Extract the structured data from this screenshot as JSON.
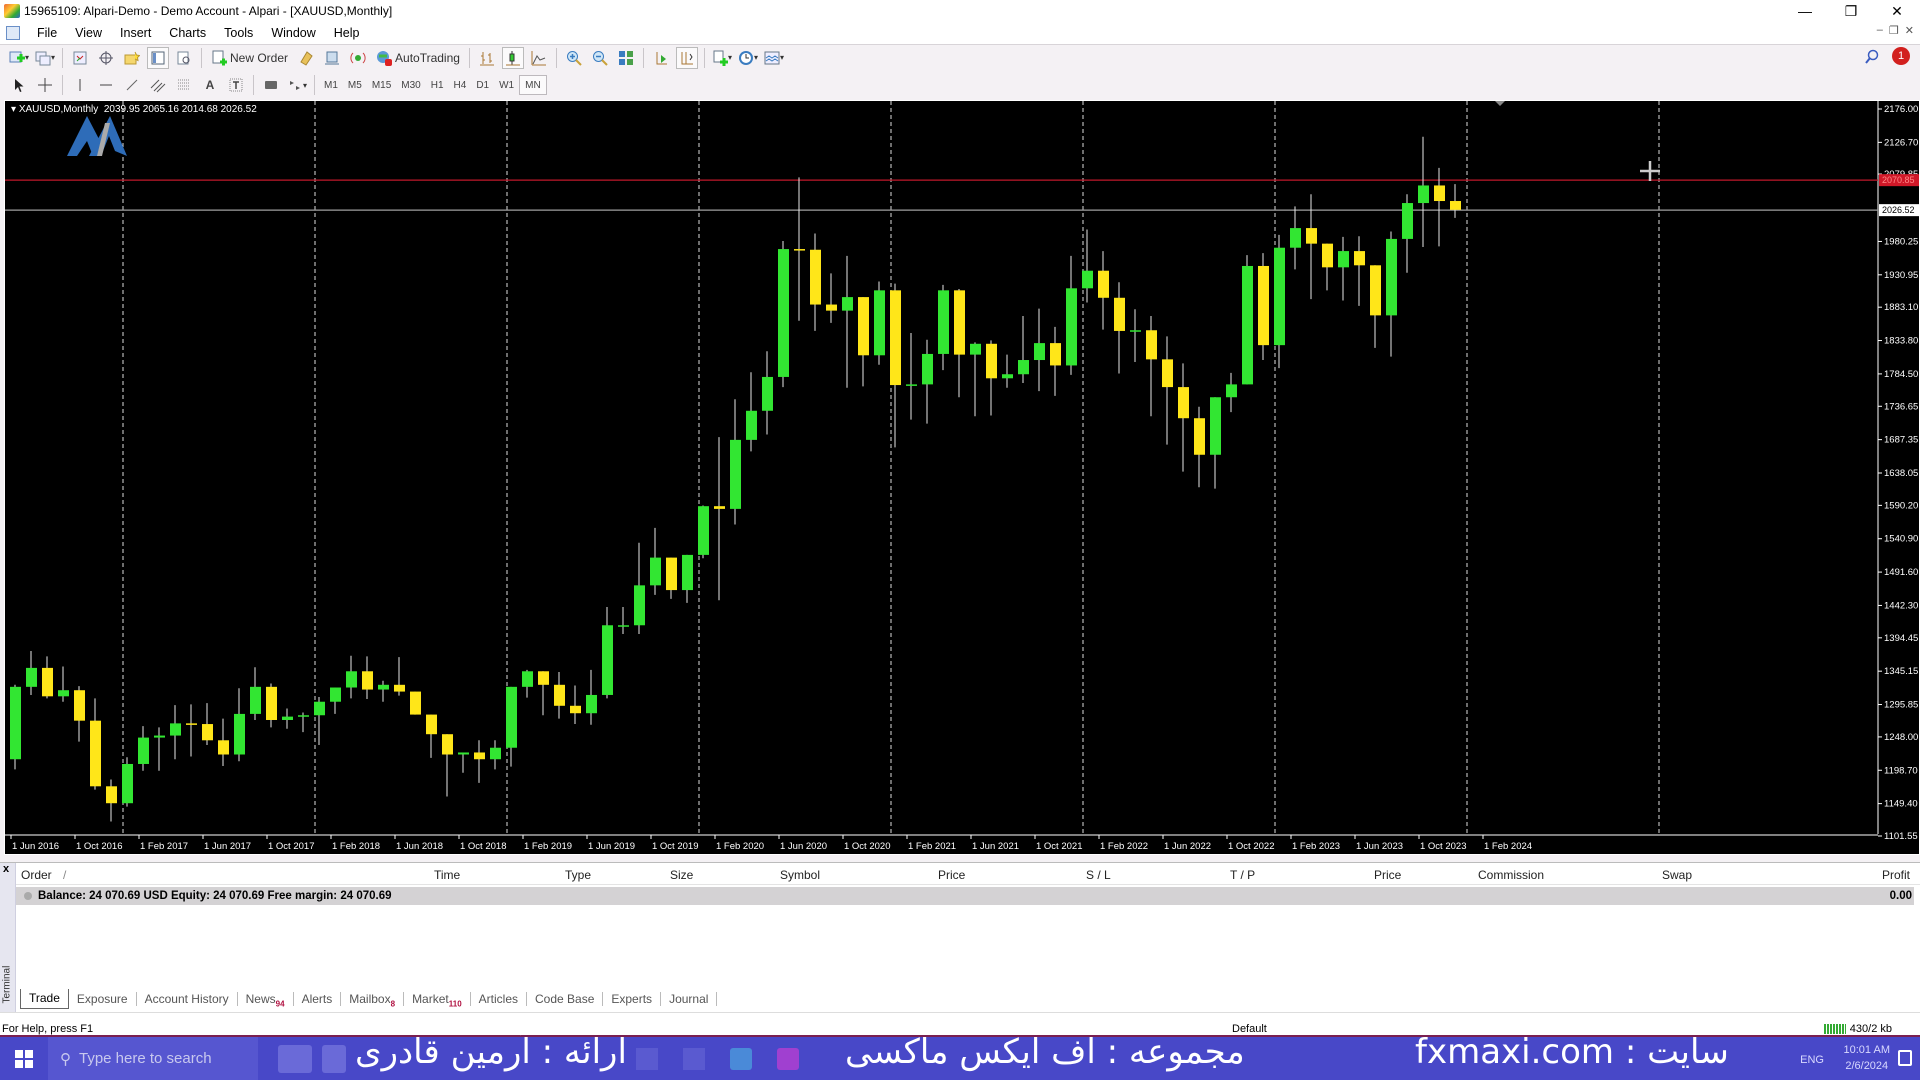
{
  "window": {
    "title": "15965109: Alpari-Demo - Demo Account - Alpari - [XAUUSD,Monthly]",
    "controls": [
      "minimize",
      "restore",
      "close"
    ]
  },
  "menu": [
    "File",
    "View",
    "Insert",
    "Charts",
    "Tools",
    "Window",
    "Help"
  ],
  "toolbar": {
    "new_order": "New Order",
    "auto_trading": "AutoTrading",
    "timeframes": [
      "M1",
      "M5",
      "M15",
      "M30",
      "H1",
      "H4",
      "D1",
      "W1",
      "MN"
    ],
    "active_timeframe": "MN",
    "notification_count": "1"
  },
  "chart": {
    "symbol_legend": "XAUUSD,Monthly  2039.95 2065.16 2014.68 2026.52",
    "current_price_label": "2026.52",
    "hline_price_label": "2070.85",
    "colors": {
      "bull": "#32e632",
      "bear": "#ffe619",
      "wick": "#e8e8e8",
      "hline": "#c0182a",
      "price_line": "#a0a0a0",
      "background": "#000000"
    }
  },
  "chart_data": {
    "type": "candlestick",
    "title": "XAUUSD,Monthly",
    "ohlc_header": {
      "open": 2039.95,
      "high": 2065.16,
      "low": 2014.68,
      "close": 2026.52
    },
    "y_ticks": [
      2176.0,
      2126.7,
      2079.85,
      2026.52,
      1980.25,
      1930.95,
      1883.1,
      1833.8,
      1784.5,
      1736.65,
      1687.35,
      1638.05,
      1590.2,
      1540.9,
      1491.6,
      1442.3,
      1394.45,
      1345.15,
      1295.85,
      1248.0,
      1198.7,
      1149.4,
      1101.55
    ],
    "ylim": [
      1101.55,
      2176.0
    ],
    "x_ticks": [
      "1 Jun 2016",
      "1 Oct 2016",
      "1 Feb 2017",
      "1 Jun 2017",
      "1 Oct 2017",
      "1 Feb 2018",
      "1 Jun 2018",
      "1 Oct 2018",
      "1 Feb 2019",
      "1 Jun 2019",
      "1 Oct 2019",
      "1 Feb 2020",
      "1 Jun 2020",
      "1 Oct 2020",
      "1 Feb 2021",
      "1 Jun 2021",
      "1 Oct 2021",
      "1 Feb 2022",
      "1 Jun 2022",
      "1 Oct 2022",
      "1 Feb 2023",
      "1 Jun 2023",
      "1 Oct 2023",
      "1 Feb 2024"
    ],
    "horizontal_lines": [
      {
        "price": 2070.85,
        "color": "#c0182a"
      },
      {
        "price": 2026.52,
        "color": "#a0a0a0"
      }
    ],
    "ohlc": [
      [
        1215,
        1325,
        1200,
        1322
      ],
      [
        1322,
        1375,
        1310,
        1350
      ],
      [
        1350,
        1367,
        1305,
        1308
      ],
      [
        1308,
        1352,
        1300,
        1317
      ],
      [
        1317,
        1323,
        1241,
        1272
      ],
      [
        1272,
        1305,
        1170,
        1175
      ],
      [
        1175,
        1185,
        1123,
        1150
      ],
      [
        1150,
        1218,
        1145,
        1208
      ],
      [
        1208,
        1264,
        1198,
        1247
      ],
      [
        1247,
        1262,
        1198,
        1250
      ],
      [
        1250,
        1295,
        1215,
        1268
      ],
      [
        1268,
        1296,
        1219,
        1267
      ],
      [
        1267,
        1298,
        1236,
        1243
      ],
      [
        1243,
        1275,
        1205,
        1222
      ],
      [
        1222,
        1320,
        1212,
        1282
      ],
      [
        1282,
        1351,
        1273,
        1322
      ],
      [
        1322,
        1327,
        1262,
        1273
      ],
      [
        1273,
        1290,
        1260,
        1278
      ],
      [
        1278,
        1284,
        1255,
        1280
      ],
      [
        1280,
        1307,
        1236,
        1300
      ],
      [
        1300,
        1320,
        1282,
        1321
      ],
      [
        1321,
        1368,
        1305,
        1345
      ],
      [
        1345,
        1367,
        1304,
        1318
      ],
      [
        1318,
        1331,
        1300,
        1325
      ],
      [
        1325,
        1366,
        1309,
        1315
      ],
      [
        1315,
        1308,
        1282,
        1281
      ],
      [
        1281,
        1262,
        1217,
        1252
      ],
      [
        1252,
        1240,
        1160,
        1222
      ],
      [
        1222,
        1215,
        1195,
        1225
      ],
      [
        1225,
        1243,
        1180,
        1215
      ],
      [
        1215,
        1243,
        1200,
        1232
      ],
      [
        1232,
        1286,
        1204,
        1322
      ],
      [
        1322,
        1347,
        1306,
        1345
      ],
      [
        1345,
        1330,
        1280,
        1325
      ],
      [
        1325,
        1344,
        1275,
        1294
      ],
      [
        1294,
        1324,
        1267,
        1283
      ],
      [
        1283,
        1347,
        1266,
        1310
      ],
      [
        1310,
        1440,
        1305,
        1413
      ],
      [
        1413,
        1440,
        1400,
        1413
      ],
      [
        1413,
        1535,
        1400,
        1472
      ],
      [
        1472,
        1557,
        1458,
        1513
      ],
      [
        1513,
        1500,
        1452,
        1465
      ],
      [
        1465,
        1489,
        1446,
        1517
      ],
      [
        1517,
        1590,
        1512,
        1589
      ],
      [
        1589,
        1691,
        1450,
        1585
      ],
      [
        1585,
        1747,
        1562,
        1687
      ],
      [
        1687,
        1787,
        1670,
        1730
      ],
      [
        1730,
        1818,
        1695,
        1780
      ],
      [
        1780,
        1981,
        1765,
        1969
      ],
      [
        1969,
        2075,
        1863,
        1968
      ],
      [
        1968,
        1992,
        1848,
        1887
      ],
      [
        1887,
        1933,
        1860,
        1878
      ],
      [
        1878,
        1959,
        1764,
        1898
      ],
      [
        1898,
        1875,
        1766,
        1812
      ],
      [
        1812,
        1921,
        1798,
        1908
      ],
      [
        1908,
        1918,
        1676,
        1768
      ],
      [
        1768,
        1845,
        1717,
        1769
      ],
      [
        1769,
        1835,
        1711,
        1814
      ],
      [
        1814,
        1916,
        1790,
        1908
      ],
      [
        1908,
        1910,
        1750,
        1813
      ],
      [
        1813,
        1831,
        1722,
        1829
      ],
      [
        1829,
        1834,
        1723,
        1778
      ],
      [
        1778,
        1813,
        1764,
        1784
      ],
      [
        1784,
        1870,
        1771,
        1805
      ],
      [
        1805,
        1881,
        1759,
        1830
      ],
      [
        1830,
        1854,
        1752,
        1797
      ],
      [
        1797,
        1959,
        1783,
        1911
      ],
      [
        1911,
        1998,
        1890,
        1937
      ],
      [
        1937,
        1966,
        1850,
        1897
      ],
      [
        1897,
        1920,
        1785,
        1848
      ],
      [
        1848,
        1880,
        1802,
        1849
      ],
      [
        1849,
        1870,
        1722,
        1806
      ],
      [
        1806,
        1840,
        1680,
        1765
      ],
      [
        1765,
        1800,
        1640,
        1719
      ],
      [
        1719,
        1736,
        1617,
        1665
      ],
      [
        1665,
        1729,
        1615,
        1750
      ],
      [
        1750,
        1786,
        1728,
        1769
      ],
      [
        1769,
        1960,
        1804,
        1944
      ],
      [
        1944,
        1963,
        1805,
        1827
      ],
      [
        1827,
        1990,
        1793,
        1971
      ],
      [
        1971,
        2032,
        1939,
        2000
      ],
      [
        2000,
        2050,
        1895,
        1977
      ],
      [
        1977,
        1969,
        1908,
        1942
      ],
      [
        1942,
        1987,
        1893,
        1966
      ],
      [
        1966,
        1988,
        1885,
        1945
      ],
      [
        1945,
        1929,
        1823,
        1871
      ],
      [
        1871,
        1995,
        1810,
        1984
      ],
      [
        1984,
        2050,
        1934,
        2037
      ],
      [
        2037,
        2135,
        1972,
        2063
      ],
      [
        2063,
        2089,
        1973,
        2040
      ],
      [
        2040,
        2065,
        2015,
        2027
      ]
    ]
  },
  "terminal": {
    "close_label": "x",
    "side_label": "Terminal",
    "columns": [
      "Order",
      "/",
      "Time",
      "Type",
      "Size",
      "Symbol",
      "Price",
      "S / L",
      "T / P",
      "Price",
      "Commission",
      "Swap",
      "Profit"
    ],
    "balance_text": "Balance: 24 070.69 USD  Equity: 24 070.69  Free margin: 24 070.69",
    "profit": "0.00",
    "tabs": [
      {
        "label": "Trade",
        "badge": "",
        "active": true
      },
      {
        "label": "Exposure",
        "badge": ""
      },
      {
        "label": "Account History",
        "badge": ""
      },
      {
        "label": "News",
        "badge": "94"
      },
      {
        "label": "Alerts",
        "badge": ""
      },
      {
        "label": "Mailbox",
        "badge": "8"
      },
      {
        "label": "Market",
        "badge": "110"
      },
      {
        "label": "Articles",
        "badge": ""
      },
      {
        "label": "Code Base",
        "badge": ""
      },
      {
        "label": "Experts",
        "badge": ""
      },
      {
        "label": "Journal",
        "badge": ""
      }
    ]
  },
  "statusbar": {
    "help": "For Help, press F1",
    "profile": "Default",
    "connection": "430/2 kb"
  },
  "taskbar": {
    "search_placeholder": "Type here to search",
    "overlay_presenter": "ارائه : آرمین قادری",
    "overlay_collection": "مجموعه : اف ایکس ماکسی",
    "overlay_site": "fxmaxi.com : سایت",
    "lang": "ENG",
    "time": "10:01 AM",
    "date": "2/6/2024"
  }
}
